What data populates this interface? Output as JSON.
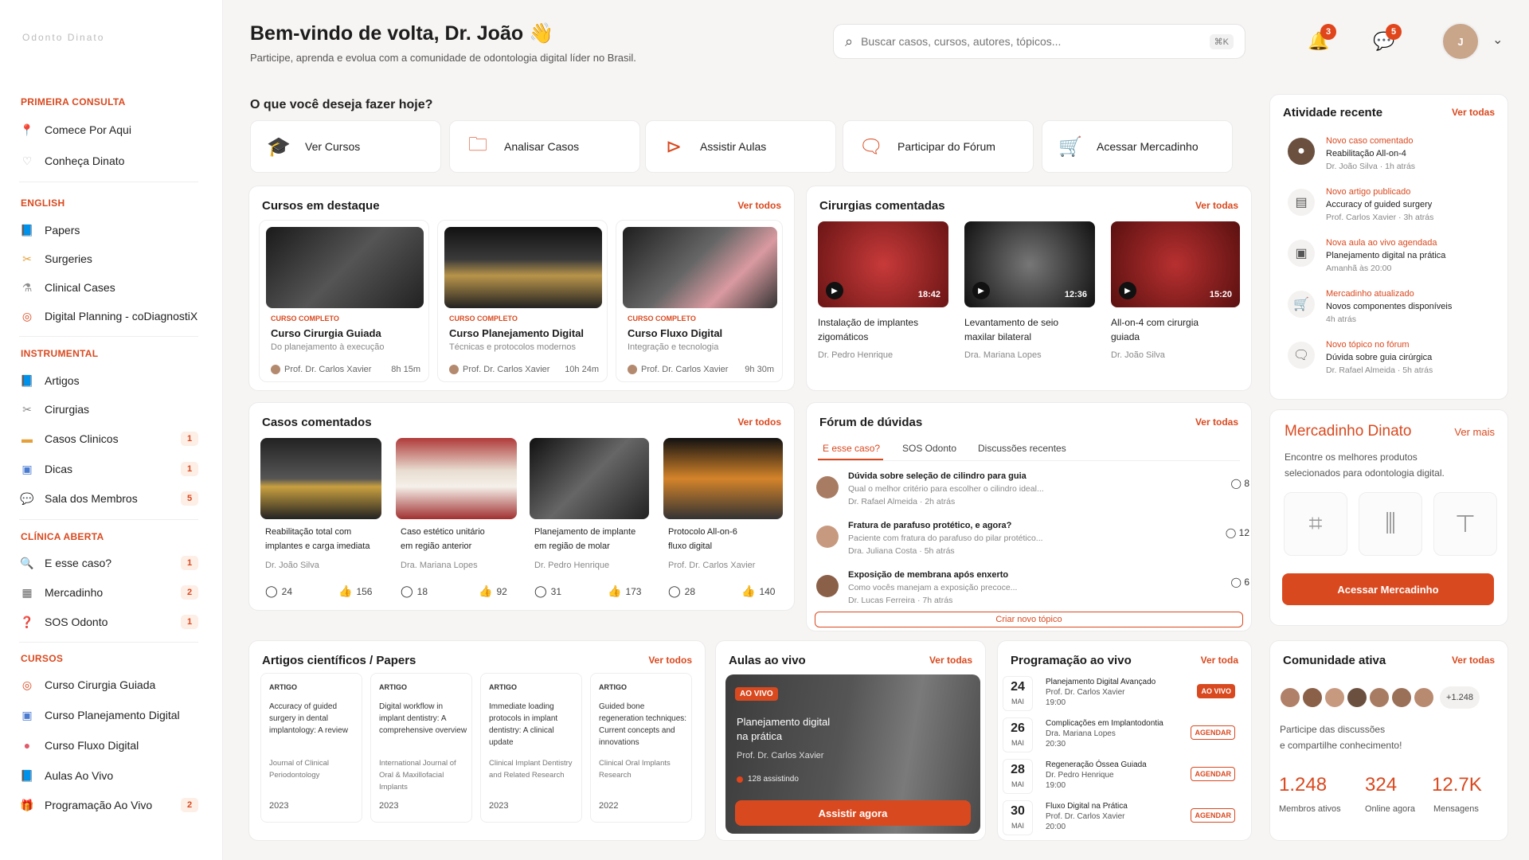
{
  "sidebar": {
    "logo": "Odonto Dinato",
    "sections": [
      {
        "title": "PRIMEIRA CONSULTA",
        "items": [
          {
            "label": "Comece Por Aqui",
            "icon": "pin-icon"
          },
          {
            "label": "Conheça Dinato",
            "icon": "tooth-icon"
          }
        ]
      },
      {
        "title": "ENGLISH",
        "items": [
          {
            "label": "Papers",
            "icon": "book-icon"
          },
          {
            "label": "Surgeries",
            "icon": "scalpel-icon"
          },
          {
            "label": "Clinical Cases",
            "icon": "flask-icon"
          },
          {
            "label": "Digital Planning - coDiagnostiX",
            "icon": "target-icon"
          }
        ]
      },
      {
        "title": "INSTRUMENTAL",
        "items": [
          {
            "label": "Artigos",
            "icon": "book-icon"
          },
          {
            "label": "Cirurgias",
            "icon": "scalpel-icon"
          },
          {
            "label": "Casos Clinicos",
            "icon": "folder-icon",
            "badge": "1"
          },
          {
            "label": "Dicas",
            "icon": "monitor-icon",
            "badge": "1"
          },
          {
            "label": "Sala dos Membros",
            "icon": "chat-icon",
            "badge": "5"
          }
        ]
      },
      {
        "title": "CLÍNICA ABERTA",
        "items": [
          {
            "label": "E esse caso?",
            "icon": "search-icon",
            "badge": "1"
          },
          {
            "label": "Mercadinho",
            "icon": "register-icon",
            "badge": "2"
          },
          {
            "label": "SOS Odonto",
            "icon": "question-icon",
            "badge": "1"
          }
        ]
      },
      {
        "title": "CURSOS",
        "items": [
          {
            "label": "Curso Cirurgia Guiada",
            "icon": "target-icon"
          },
          {
            "label": "Curso Planejamento Digital",
            "icon": "monitor-icon"
          },
          {
            "label": "Curso Fluxo Digital",
            "icon": "blob-icon"
          },
          {
            "label": "Aulas Ao Vivo",
            "icon": "book-icon"
          },
          {
            "label": "Programação Ao Vivo",
            "icon": "gift-icon",
            "badge": "2"
          }
        ]
      }
    ]
  },
  "header": {
    "greeting": "Bem-vindo de volta, Dr. João 👋",
    "subtitle": "Participe, aprenda e evolua com a comunidade de odontologia digital líder no Brasil.",
    "search_placeholder": "Buscar casos, cursos, autores, tópicos...",
    "search_shortcut": "⌘K",
    "notifications": "3",
    "messages": "5"
  },
  "quick": {
    "title": "O que você deseja fazer hoje?",
    "actions": [
      "Ver Cursos",
      "Analisar Casos",
      "Assistir Aulas",
      "Participar do Fórum",
      "Acessar Mercadinho"
    ]
  },
  "courses": {
    "title": "Cursos em destaque",
    "link": "Ver todos",
    "items": [
      {
        "tag": "CURSO COMPLETO",
        "title": "Curso Cirurgia Guiada",
        "desc": "Do planejamento à execução",
        "author": "Prof. Dr. Carlos Xavier",
        "duration": "8h 15m"
      },
      {
        "tag": "CURSO COMPLETO",
        "title": "Curso Planejamento Digital",
        "desc": "Técnicas e protocolos modernos",
        "author": "Prof. Dr. Carlos Xavier",
        "duration": "10h 24m"
      },
      {
        "tag": "CURSO COMPLETO",
        "title": "Curso Fluxo Digital",
        "desc": "Integração e tecnologia",
        "author": "Prof. Dr. Carlos Xavier",
        "duration": "9h 30m"
      }
    ]
  },
  "surgeries": {
    "title": "Cirurgias comentadas",
    "link": "Ver todas",
    "items": [
      {
        "title1": "Instalação de implantes",
        "title2": "zigomáticos",
        "author": "Dr. Pedro Henrique",
        "duration": "18:42"
      },
      {
        "title1": "Levantamento de seio",
        "title2": "maxilar bilateral",
        "author": "Dra. Mariana Lopes",
        "duration": "12:36"
      },
      {
        "title1": "All-on-4 com cirurgia",
        "title2": "guiada",
        "author": "Dr. João Silva",
        "duration": "15:20"
      }
    ]
  },
  "cases": {
    "title": "Casos comentados",
    "link": "Ver todos",
    "items": [
      {
        "title1": "Reabilitação total com",
        "title2": "implantes e carga imediata",
        "author": "Dr. João Silva",
        "comments": "24",
        "likes": "156"
      },
      {
        "title1": "Caso estético unitário",
        "title2": "em região anterior",
        "author": "Dra. Mariana Lopes",
        "comments": "18",
        "likes": "92"
      },
      {
        "title1": "Planejamento de implante",
        "title2": "em região de molar",
        "author": "Dr. Pedro Henrique",
        "comments": "31",
        "likes": "173"
      },
      {
        "title1": "Protocolo All-on-6",
        "title2": "fluxo digital",
        "author": "Prof. Dr. Carlos Xavier",
        "comments": "28",
        "likes": "140"
      }
    ]
  },
  "forum": {
    "title": "Fórum de dúvidas",
    "link": "Ver todas",
    "tabs": [
      "E esse caso?",
      "SOS Odonto",
      "Discussões recentes"
    ],
    "items": [
      {
        "q": "Dúvida sobre seleção de cilindro para guia",
        "d": "Qual o melhor critério para escolher o cilindro ideal...",
        "author": "Dr. Rafael Almeida",
        "time": "2h atrás",
        "count": "8"
      },
      {
        "q": "Fratura de parafuso protético, e agora?",
        "d": "Paciente com fratura do parafuso do pilar protético...",
        "author": "Dra. Juliana Costa",
        "time": "5h atrás",
        "count": "12"
      },
      {
        "q": "Exposição de membrana após enxerto",
        "d": "Como vocês manejam a exposição precoce...",
        "author": "Dr. Lucas Ferreira",
        "time": "7h atrás",
        "count": "6"
      }
    ],
    "new_topic": "Criar novo tópico"
  },
  "activity": {
    "title": "Atividade recente",
    "link": "Ver todas",
    "items": [
      {
        "t": "Novo caso comentado",
        "s": "Reabilitação All-on-4",
        "m": "Dr. João Silva · 1h atrás"
      },
      {
        "t": "Novo artigo publicado",
        "s": "Accuracy of guided surgery",
        "m": "Prof. Carlos Xavier · 3h atrás"
      },
      {
        "t": "Nova aula ao vivo agendada",
        "s": "Planejamento digital na prática",
        "m": "Amanhã às 20:00"
      },
      {
        "t": "Mercadinho atualizado",
        "s": "Novos componentes disponíveis",
        "m": "4h atrás"
      },
      {
        "t": "Novo tópico no fórum",
        "s": "Dúvida sobre guia cirúrgica",
        "m": "Dr. Rafael Almeida · 5h atrás"
      }
    ]
  },
  "market": {
    "title": "Mercadinho Dinato",
    "link": "Ver mais",
    "desc1": "Encontre os melhores produtos",
    "desc2": "selecionados para odontologia digital.",
    "button": "Acessar Mercadinho"
  },
  "papers": {
    "title": "Artigos científicos / Papers",
    "link": "Ver todos",
    "items": [
      {
        "label": "ARTIGO",
        "title": "Accuracy of guided surgery in dental implantology: A review",
        "journal": "Journal of Clinical Periodontology",
        "year": "2023"
      },
      {
        "label": "ARTIGO",
        "title": "Digital workflow in implant dentistry: A comprehensive overview",
        "journal": "International Journal of Oral & Maxillofacial Implants",
        "year": "2023"
      },
      {
        "label": "ARTIGO",
        "title": "Immediate loading protocols in implant dentistry: A clinical update",
        "journal": "Clinical Implant Dentistry and Related Research",
        "year": "2023"
      },
      {
        "label": "ARTIGO",
        "title": "Guided bone regeneration techniques: Current concepts and innovations",
        "journal": "Clinical Oral Implants Research",
        "year": "2022"
      }
    ]
  },
  "live": {
    "title": "Aulas ao vivo",
    "link": "Ver todas",
    "badge": "AO VIVO",
    "t1": "Planejamento digital",
    "t2": "na prática",
    "author": "Prof. Dr. Carlos Xavier",
    "watching": "128 assistindo",
    "button": "Assistir agora"
  },
  "schedule": {
    "title": "Programação ao vivo",
    "link": "Ver toda",
    "items": [
      {
        "day": "24",
        "mon": "MAI",
        "t": "Planejamento Digital Avançado",
        "a": "Prof. Dr. Carlos Xavier",
        "h": "19:00",
        "badge": "AO VIVO",
        "live": true
      },
      {
        "day": "26",
        "mon": "MAI",
        "t": "Complicações em Implantodontia",
        "a": "Dra. Mariana Lopes",
        "h": "20:30",
        "badge": "AGENDAR",
        "live": false
      },
      {
        "day": "28",
        "mon": "MAI",
        "t": "Regeneração Óssea Guiada",
        "a": "Dr. Pedro Henrique",
        "h": "19:00",
        "badge": "AGENDAR",
        "live": false
      },
      {
        "day": "30",
        "mon": "MAI",
        "t": "Fluxo Digital na Prática",
        "a": "Prof. Dr. Carlos Xavier",
        "h": "20:00",
        "badge": "AGENDAR",
        "live": false
      }
    ]
  },
  "community": {
    "title": "Comunidade ativa",
    "link": "Ver todas",
    "more": "+1.248",
    "desc1": "Participe das discussões",
    "desc2": "e compartilhe conhecimento!",
    "stats": [
      {
        "v": "1.248",
        "l": "Membros ativos"
      },
      {
        "v": "324",
        "l": "Online agora"
      },
      {
        "v": "12.7K",
        "l": "Mensagens"
      }
    ]
  },
  "colors": {
    "accent": "#d9491f",
    "background": "#f7f5f3"
  }
}
